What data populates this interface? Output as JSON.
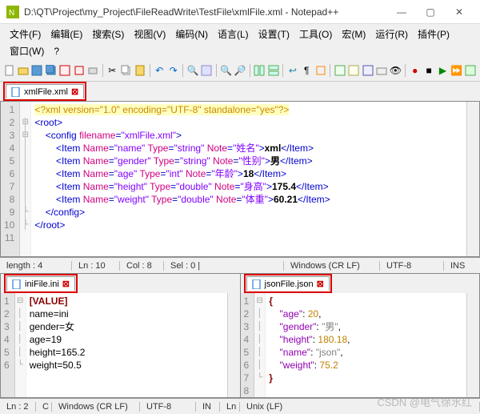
{
  "title": "D:\\QT\\Project\\my_Project\\FileReadWrite\\TestFile\\xmlFile.xml - Notepad++",
  "menu": {
    "items": [
      "文件(F)",
      "编辑(E)",
      "搜索(S)",
      "视图(V)",
      "编码(N)",
      "语言(L)",
      "设置(T)",
      "工具(O)",
      "宏(M)",
      "运行(R)",
      "插件(P)",
      "窗口(W)",
      "?"
    ]
  },
  "tabs": {
    "top": "xmlFile.xml",
    "bottom_left": "iniFile.ini",
    "bottom_right": "jsonFile.json"
  },
  "xml": {
    "lines": [
      1,
      2,
      3,
      4,
      5,
      6,
      7,
      8,
      9,
      10,
      11
    ],
    "decl": "<?xml version=\"1.0\" encoding=\"UTF-8\" standalone=\"yes\"?>",
    "root_open": "<root>",
    "config_open": "<config",
    "config_attr_name": "filename",
    "config_attr_val": "\"xmlFile.xml\"",
    "config_close": ">",
    "items": [
      {
        "name": "\"name\"",
        "type": "\"string\"",
        "note": "\"姓名\"",
        "text": "xml"
      },
      {
        "name": "\"gender\"",
        "type": "\"string\"",
        "note": "\"性别\"",
        "text": "男"
      },
      {
        "name": "\"age\"",
        "type": "\"int\"",
        "note": "\"年龄\"",
        "text": "18"
      },
      {
        "name": "\"height\"",
        "type": "\"double\"",
        "note": "\"身高\"",
        "text": "175.4"
      },
      {
        "name": "\"weight\"",
        "type": "\"double\"",
        "note": "\"体重\"",
        "text": "60.21"
      }
    ],
    "config_end": "</config>",
    "root_end": "</root>"
  },
  "ini": {
    "lines": [
      1,
      2,
      3,
      4,
      5,
      6
    ],
    "section": "[VALUE]",
    "rows": [
      "name=ini",
      "gender=女",
      "age=19",
      "height=165.2",
      "weight=50.5"
    ]
  },
  "json": {
    "lines": [
      1,
      2,
      3,
      4,
      5,
      6,
      7,
      8
    ],
    "body": [
      {
        "k": "\"age\"",
        "v": "20",
        "num": true,
        "c": ","
      },
      {
        "k": "\"gender\"",
        "v": "\"男\"",
        "num": false,
        "c": ","
      },
      {
        "k": "\"height\"",
        "v": "180.18",
        "num": true,
        "c": ","
      },
      {
        "k": "\"name\"",
        "v": "\"json\"",
        "num": false,
        "c": ","
      },
      {
        "k": "\"weight\"",
        "v": "75.2",
        "num": true,
        "c": ""
      }
    ]
  },
  "status_top": {
    "length": "length : 4",
    "ln": "Ln : 10",
    "col": "Col : 8",
    "sel": "Sel : 0 |",
    "eol": "Windows (CR LF)",
    "enc": "UTF-8",
    "ins": "INS"
  },
  "status_bottom": {
    "ln1": "Ln : 2",
    "col1": "C",
    "eol1": "Windows (CR LF)",
    "enc1": "UTF-8",
    "ins1": "IN",
    "ln2": "Ln",
    "eol2": "Unix (LF)",
    "watermark": "CSDN @电气徐水红"
  }
}
